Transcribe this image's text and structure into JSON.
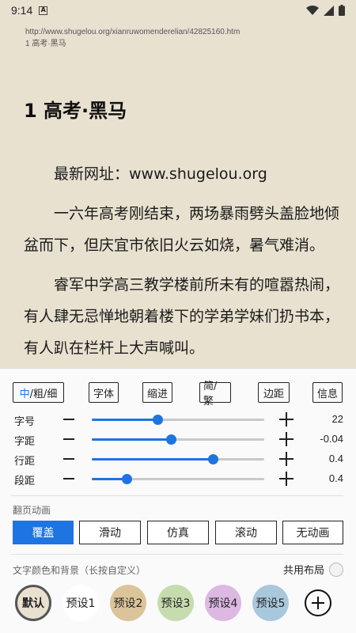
{
  "status_bar": {
    "time": "9:14",
    "notification_letter": "A"
  },
  "reader": {
    "url": "http://www.shugelou.org/xianruwomenderelian/42825160.htm",
    "header_chapter": "1 高考·黑马",
    "chapter_title": "1 高考·黑马",
    "paragraphs": [
      "最新网址：www.shugelou.org",
      "一六年高考刚结束，两场暴雨劈头盖脸地倾盆而下，但庆宜市依旧火云如烧，暑气难消。",
      "睿军中学高三教学楼前所未有的喧嚣热闹，有人肆无忌惮地朝着楼下的学弟学妹们扔书本，有人趴在栏杆上大声喊叫。"
    ]
  },
  "settings_panel": {
    "tools": {
      "weight_seg_1": "中",
      "weight_seg_2": "/粗/细",
      "font": "字体",
      "indent": "缩进",
      "simp_trad": "简/繁",
      "margin": "边距",
      "info": "信息"
    },
    "sliders": [
      {
        "label": "字号",
        "value": "22",
        "fraction": 0.38
      },
      {
        "label": "字距",
        "value": "-0.04",
        "fraction": 0.46
      },
      {
        "label": "行距",
        "value": "0.4",
        "fraction": 0.7
      },
      {
        "label": "段距",
        "value": "0.4",
        "fraction": 0.2
      }
    ],
    "page_animation_label": "翻页动画",
    "animations": [
      {
        "label": "覆盖",
        "active": true
      },
      {
        "label": "滑动",
        "active": false
      },
      {
        "label": "仿真",
        "active": false
      },
      {
        "label": "滚动",
        "active": false
      },
      {
        "label": "无动画",
        "active": false
      }
    ],
    "color_section_label": "文字颜色和背景（长按自定义）",
    "shared_layout_label": "共用布局",
    "presets": [
      {
        "label": "默认",
        "color": "#e8e1d0",
        "selected": true
      },
      {
        "label": "预设1",
        "color": "#ffffff",
        "selected": false
      },
      {
        "label": "预设2",
        "color": "#dcc49a",
        "selected": false
      },
      {
        "label": "预设3",
        "color": "#c7dcae",
        "selected": false
      },
      {
        "label": "预设4",
        "color": "#dcb8e2",
        "selected": false
      },
      {
        "label": "预设5",
        "color": "#a9c8dc",
        "selected": false
      }
    ],
    "colors": {
      "accent": "#1e74e0"
    }
  }
}
